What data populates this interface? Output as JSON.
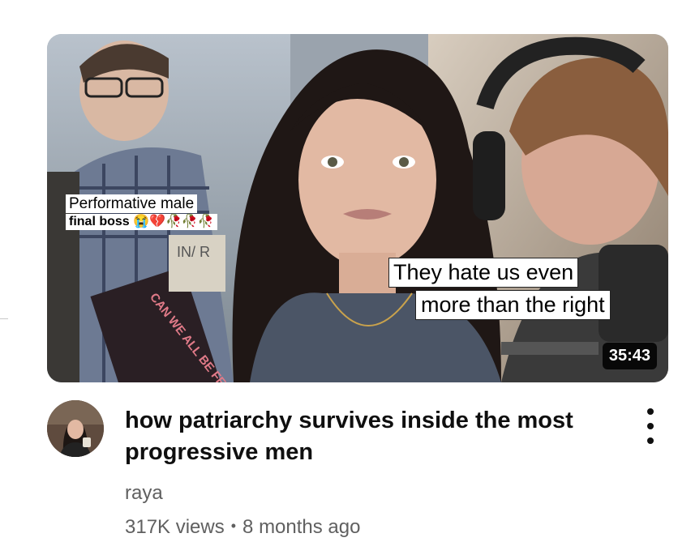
{
  "video": {
    "thumbnail": {
      "caption_left_line1": "Performative male",
      "caption_left_line2": "final boss 😭💔🥀🥀🥀",
      "caption_right_line1": "They hate us even",
      "caption_right_line2": "more than the right",
      "book_cover_text": "CAN WE ALL BE FEMINISTS?",
      "tote_text": "IN/ R",
      "duration": "35:43"
    },
    "title": "how patriarchy survives inside the most progressive men",
    "channel": "raya",
    "views": "317K views",
    "separator": "•",
    "age": "8 months ago",
    "menu_icon": "more-vert-icon"
  },
  "colors": {
    "title": "#0f0f0f",
    "secondary_text": "#606060",
    "duration_bg": "#000000",
    "caption_bg": "#ffffff"
  }
}
